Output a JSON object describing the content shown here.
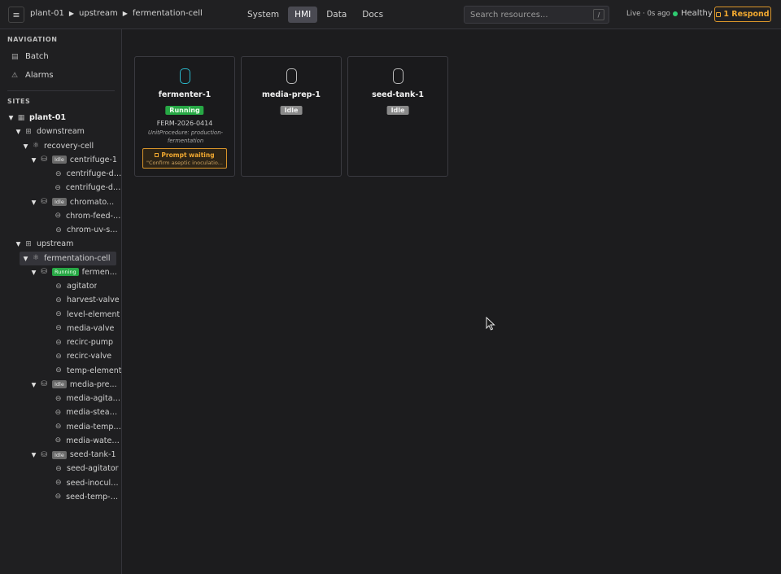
{
  "header": {
    "menu_icon": "hamburger-icon",
    "breadcrumb": [
      "plant-01",
      "upstream",
      "fermentation-cell"
    ],
    "tabs": [
      {
        "label": "System",
        "active": false
      },
      {
        "label": "HMI",
        "active": true
      },
      {
        "label": "Data",
        "active": false
      },
      {
        "label": "Docs",
        "active": false
      }
    ],
    "search_placeholder": "Search resources...",
    "search_shortcut": "/",
    "live_status": "Live · 0s ago",
    "health": "Healthy",
    "respond": "1 Respond"
  },
  "sidebar": {
    "navigation_title": "NAVIGATION",
    "nav_items": [
      {
        "label": "Batch",
        "icon": "document-icon"
      },
      {
        "label": "Alarms",
        "icon": "warning-icon"
      }
    ],
    "sites_title": "SITES",
    "tree": [
      {
        "label": "plant-01",
        "depth": 0,
        "icon": "building-icon",
        "expanded": true,
        "bold": true
      },
      {
        "label": "downstream",
        "depth": 1,
        "icon": "area-icon",
        "expanded": true
      },
      {
        "label": "recovery-cell",
        "depth": 2,
        "icon": "cell-icon",
        "expanded": true
      },
      {
        "label": "centrifuge-1",
        "depth": 3,
        "icon": "unit-icon",
        "expanded": true,
        "badge": "Idle"
      },
      {
        "label": "centrifuge-di...",
        "depth": 4,
        "icon": "module-icon"
      },
      {
        "label": "centrifuge-dri...",
        "depth": 4,
        "icon": "module-icon"
      },
      {
        "label": "chromato...",
        "depth": 3,
        "icon": "unit-icon",
        "expanded": true,
        "badge": "Idle"
      },
      {
        "label": "chrom-feed-p...",
        "depth": 4,
        "icon": "module-icon"
      },
      {
        "label": "chrom-uv-se...",
        "depth": 4,
        "icon": "module-icon"
      },
      {
        "label": "upstream",
        "depth": 1,
        "icon": "area-icon",
        "expanded": true
      },
      {
        "label": "fermentation-cell",
        "depth": 2,
        "icon": "cell-icon",
        "expanded": true,
        "selected": true
      },
      {
        "label": "fermen...",
        "depth": 3,
        "icon": "unit-icon",
        "expanded": true,
        "badge": "Running"
      },
      {
        "label": "agitator",
        "depth": 4,
        "icon": "module-icon"
      },
      {
        "label": "harvest-valve",
        "depth": 4,
        "icon": "module-icon"
      },
      {
        "label": "level-element",
        "depth": 4,
        "icon": "module-icon"
      },
      {
        "label": "media-valve",
        "depth": 4,
        "icon": "module-icon"
      },
      {
        "label": "recirc-pump",
        "depth": 4,
        "icon": "module-icon"
      },
      {
        "label": "recirc-valve",
        "depth": 4,
        "icon": "module-icon"
      },
      {
        "label": "temp-element",
        "depth": 4,
        "icon": "module-icon"
      },
      {
        "label": "media-pre...",
        "depth": 3,
        "icon": "unit-icon",
        "expanded": true,
        "badge": "Idle"
      },
      {
        "label": "media-agitator",
        "depth": 4,
        "icon": "module-icon"
      },
      {
        "label": "media-steam...",
        "depth": 4,
        "icon": "module-icon"
      },
      {
        "label": "media-temp-...",
        "depth": 4,
        "icon": "module-icon"
      },
      {
        "label": "media-water-...",
        "depth": 4,
        "icon": "module-icon"
      },
      {
        "label": "seed-tank-1",
        "depth": 3,
        "icon": "unit-icon",
        "expanded": true,
        "badge": "Idle"
      },
      {
        "label": "seed-agitator",
        "depth": 4,
        "icon": "module-icon"
      },
      {
        "label": "seed-inoculu...",
        "depth": 4,
        "icon": "module-icon"
      },
      {
        "label": "seed-temp-el...",
        "depth": 4,
        "icon": "module-icon"
      }
    ]
  },
  "cards": [
    {
      "name": "fermenter-1",
      "status": "Running",
      "active": true,
      "batch_id": "FERM-2026-0414",
      "unit_procedure": "UnitProcedure: production-fermentation",
      "prompt_title": "Prompt waiting",
      "prompt_msg": "\"Confirm aseptic inoculatio..."
    },
    {
      "name": "media-prep-1",
      "status": "Idle",
      "active": false
    },
    {
      "name": "seed-tank-1",
      "status": "Idle",
      "active": false
    }
  ],
  "colors": {
    "running": "#27a845",
    "idle": "#8a8a8a",
    "accent_orange": "#f0a830",
    "vessel_active": "#2ab7ca",
    "healthy": "#2ecc71"
  }
}
